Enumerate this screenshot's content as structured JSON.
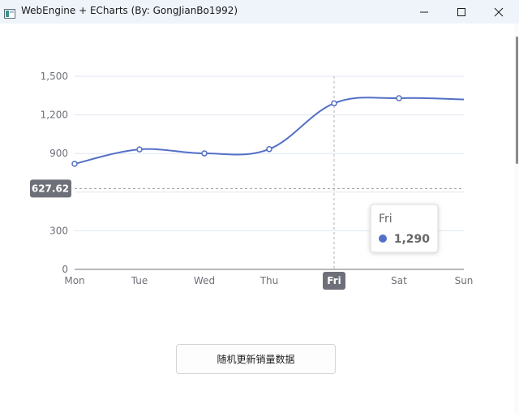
{
  "window": {
    "title": "WebEngine + ECharts (By: GongJianBo1992)",
    "icons": [
      "app-icon",
      "minimize-icon",
      "maximize-icon",
      "close-icon"
    ]
  },
  "chart_data": {
    "type": "line",
    "smooth": true,
    "categories": [
      "Mon",
      "Tue",
      "Wed",
      "Thu",
      "Fri",
      "Sat",
      "Sun"
    ],
    "series": [
      {
        "values": [
          820,
          932,
          901,
          934,
          1290,
          1330,
          1320
        ],
        "color": "#5470c6"
      }
    ],
    "y_ticks": [
      0,
      300,
      600,
      900,
      1200,
      1500
    ],
    "y_tick_labels": [
      "0",
      "300",
      "",
      "900",
      "1,200",
      "1,500"
    ],
    "ylim": [
      0,
      1500
    ],
    "grid": true,
    "pointer": {
      "y_value_label": "627.62",
      "y_value": 627.62,
      "x_category_label": "Fri",
      "x_category": "Fri"
    },
    "tooltip": {
      "category": "Fri",
      "value_label": "1,290",
      "marker_color": "#5470c6"
    }
  },
  "controls": {
    "update_button_label": "随机更新销量数据"
  }
}
